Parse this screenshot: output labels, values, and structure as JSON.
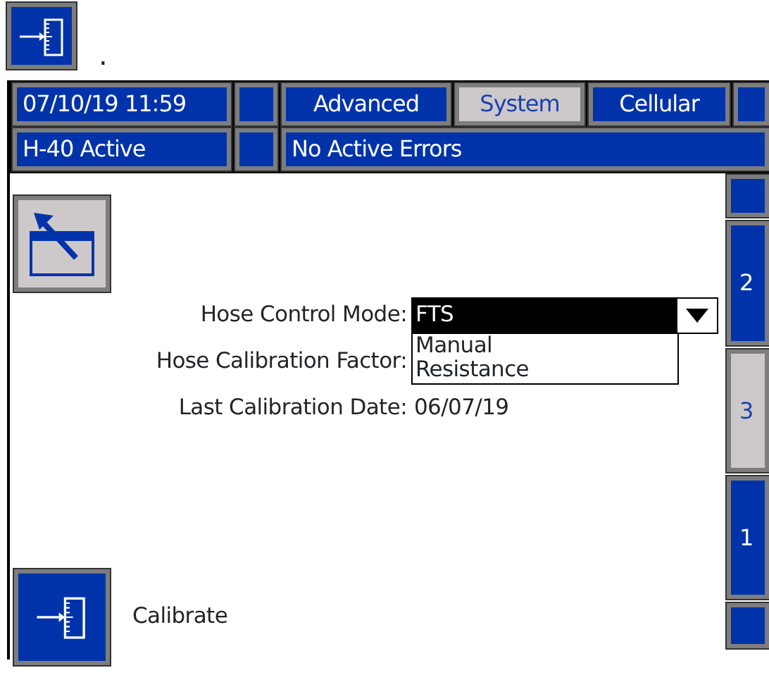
{
  "note": ".",
  "header": {
    "datetime": "07/10/19 11:59",
    "tabs": [
      {
        "label": "Advanced",
        "selected": false
      },
      {
        "label": "System",
        "selected": true
      },
      {
        "label": "Cellular",
        "selected": false
      }
    ],
    "status": "H-40 Active",
    "errors": "No Active Errors"
  },
  "fields": [
    {
      "label": "Hose Control Mode:",
      "kind": "dropdown",
      "value": "FTS",
      "expanded": true,
      "options": [
        "Manual",
        "Resistance"
      ]
    },
    {
      "label": "Hose Calibration Factor:",
      "kind": "text"
    },
    {
      "label": "Last Calibration Date:",
      "kind": "text",
      "value": "06/07/19"
    }
  ],
  "side_tabs": [
    {
      "selected": false
    },
    {
      "label": "2",
      "selected": false
    },
    {
      "label": "3",
      "selected": true
    },
    {
      "label": "1",
      "selected": false
    },
    {
      "selected": false
    }
  ],
  "calibrate_button": {
    "label": "Calibrate"
  }
}
